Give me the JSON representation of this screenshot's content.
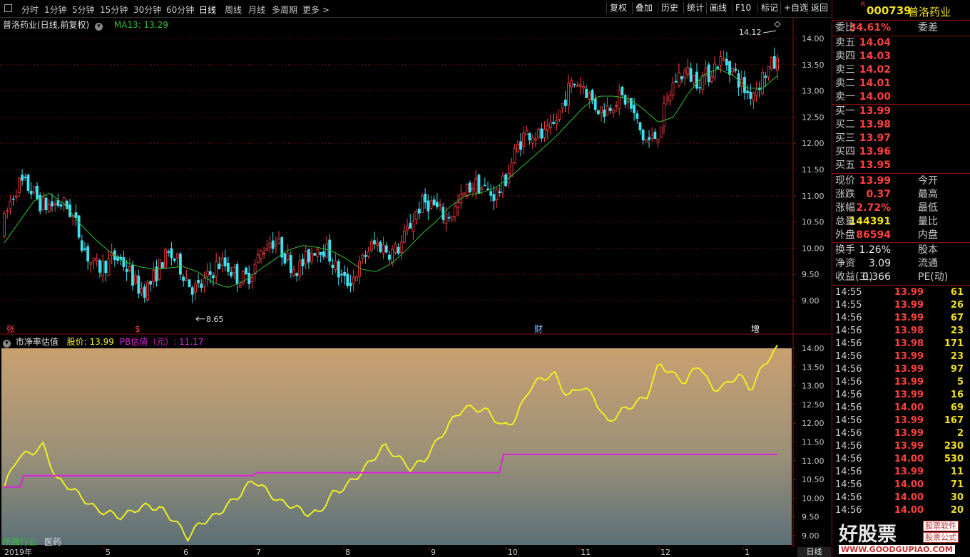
{
  "toolbar": {
    "periods": [
      "分时",
      "1分钟",
      "5分钟",
      "15分钟",
      "30分钟",
      "60分钟",
      "日线",
      "周线",
      "月线",
      "多周期",
      "更多 >"
    ],
    "buttons": [
      "复权",
      "叠加",
      "历史",
      "统计",
      "画线",
      "F10",
      "标记",
      "+自选",
      "返回"
    ]
  },
  "main": {
    "title": "普洛药业(日线,前复权)",
    "ma_label": "MA13: 13.29",
    "high_label": "14.12",
    "low_label": "8.65",
    "y_ticks": [
      "14.00",
      "13.50",
      "13.00",
      "12.50",
      "12.00",
      "11.50",
      "11.00",
      "10.50",
      "10.00",
      "9.50",
      "9.00"
    ],
    "markers": [
      {
        "text": "张",
        "color": "#ff4040"
      },
      {
        "text": "$",
        "color": "#ff4040"
      },
      {
        "text": "财",
        "color": "#80c0ff"
      },
      {
        "text": "增",
        "color": "#ffffff"
      }
    ]
  },
  "lower": {
    "indicator_name": "市净率估值",
    "price_label": "股价: 13.99",
    "pb_label": "PB估值（元）: 11.17",
    "y_ticks": [
      "14.00",
      "13.50",
      "13.00",
      "12.50",
      "12.00",
      "11.50",
      "11.00",
      "10.50",
      "10.00",
      "9.50",
      "9.00"
    ],
    "industry_label": "所属行业",
    "industry_value": "医药"
  },
  "date_axis": {
    "labels": [
      "2019年",
      "5",
      "6",
      "7",
      "8",
      "9",
      "10",
      "11",
      "12",
      "1"
    ],
    "period_tab": "日线"
  },
  "quote": {
    "code": "000739",
    "name": "普洛药业",
    "r_flag": "R",
    "wei_bi_label": "委比",
    "wei_bi": "34.61%",
    "wei_cha_label": "委差",
    "asks": [
      {
        "label": "卖五",
        "price": "14.04"
      },
      {
        "label": "卖四",
        "price": "14.03"
      },
      {
        "label": "卖三",
        "price": "14.02"
      },
      {
        "label": "卖二",
        "price": "14.01"
      },
      {
        "label": "卖一",
        "price": "14.00"
      }
    ],
    "bids": [
      {
        "label": "买一",
        "price": "13.99"
      },
      {
        "label": "买二",
        "price": "13.98"
      },
      {
        "label": "买三",
        "price": "13.97"
      },
      {
        "label": "买四",
        "price": "13.96"
      },
      {
        "label": "买五",
        "price": "13.95"
      }
    ],
    "stats": [
      {
        "l1": "现价",
        "v": "13.99",
        "l2": "今开",
        "color": "red"
      },
      {
        "l1": "涨跌",
        "v": "0.37",
        "l2": "最高",
        "color": "red"
      },
      {
        "l1": "涨幅",
        "v": "2.72%",
        "l2": "最低",
        "color": "red"
      },
      {
        "l1": "总量",
        "v": "144391",
        "l2": "量比",
        "color": "yellow"
      },
      {
        "l1": "外盘",
        "v": "86594",
        "l2": "内盘",
        "color": "red"
      }
    ],
    "stats2": [
      {
        "l1": "换手",
        "v": "1.26%",
        "l2": "股本",
        "color": "white"
      },
      {
        "l1": "净资",
        "v": "3.09",
        "l2": "流通",
        "color": "white"
      },
      {
        "l1": "收益(三)",
        "v": "0.366",
        "l2": "PE(动)",
        "color": "white"
      }
    ],
    "ticks": [
      {
        "t": "14:55",
        "p": "13.99",
        "v": "61",
        "pc": "red",
        "vc": "yellow"
      },
      {
        "t": "14:55",
        "p": "13.99",
        "v": "26",
        "pc": "red",
        "vc": "yellow"
      },
      {
        "t": "14:56",
        "p": "13.99",
        "v": "67",
        "pc": "red",
        "vc": "yellow"
      },
      {
        "t": "14:56",
        "p": "13.98",
        "v": "23",
        "pc": "red",
        "vc": "yellow"
      },
      {
        "t": "14:56",
        "p": "13.98",
        "v": "171",
        "pc": "red",
        "vc": "yellow"
      },
      {
        "t": "14:56",
        "p": "13.99",
        "v": "23",
        "pc": "red",
        "vc": "yellow"
      },
      {
        "t": "14:56",
        "p": "13.99",
        "v": "97",
        "pc": "red",
        "vc": "yellow"
      },
      {
        "t": "14:56",
        "p": "13.99",
        "v": "5",
        "pc": "red",
        "vc": "yellow"
      },
      {
        "t": "14:56",
        "p": "13.99",
        "v": "16",
        "pc": "red",
        "vc": "yellow"
      },
      {
        "t": "14:56",
        "p": "14.00",
        "v": "69",
        "pc": "red",
        "vc": "yellow"
      },
      {
        "t": "14:56",
        "p": "13.99",
        "v": "167",
        "pc": "red",
        "vc": "yellow"
      },
      {
        "t": "14:56",
        "p": "13.99",
        "v": "2",
        "pc": "red",
        "vc": "yellow"
      },
      {
        "t": "14:56",
        "p": "13.99",
        "v": "230",
        "pc": "red",
        "vc": "yellow"
      },
      {
        "t": "14:56",
        "p": "14.00",
        "v": "530",
        "pc": "red",
        "vc": "magenta"
      },
      {
        "t": "14:56",
        "p": "13.99",
        "v": "11",
        "pc": "red",
        "vc": "yellow"
      },
      {
        "t": "14:56",
        "p": "14.00",
        "v": "71",
        "pc": "red",
        "vc": "yellow"
      },
      {
        "t": "14:56",
        "p": "14.00",
        "v": "30",
        "pc": "red",
        "vc": "yellow"
      },
      {
        "t": "14:56",
        "p": "14.00",
        "v": "20",
        "pc": "red",
        "vc": "yellow"
      }
    ]
  },
  "watermark": {
    "brand": "好股票",
    "tag1": "股票软件",
    "tag2": "股票公式",
    "url": "WWW.GOODGUPIAO.COM"
  },
  "colors": {
    "up": "#ff4040",
    "down": "#40e0f0",
    "ma": "#30c030",
    "price_line": "#f0f020",
    "pb_line": "#e020e0",
    "grid": "#8b1010"
  },
  "chart_data": [
    {
      "type": "line",
      "title": "普洛药业(日线,前复权)",
      "series": [
        {
          "name": "MA13",
          "values": [
            10.1,
            10.5,
            10.9,
            11.05,
            10.85,
            10.5,
            10.2,
            9.95,
            9.75,
            9.65,
            9.6,
            9.62,
            9.65,
            9.55,
            9.35,
            9.25,
            9.35,
            9.55,
            9.75,
            9.95,
            10.05,
            10.02,
            9.95,
            9.8,
            9.6,
            9.55,
            9.7,
            9.95,
            10.25,
            10.5,
            10.8,
            11.0,
            11.05,
            11.15,
            11.35,
            11.6,
            11.85,
            12.1,
            12.4,
            12.7,
            12.9,
            12.9,
            12.85,
            12.65,
            12.4,
            12.5,
            12.95,
            13.3,
            13.42,
            13.3,
            13.05,
            13.05,
            13.29
          ]
        }
      ],
      "ylim": [
        8.6,
        14.25
      ]
    },
    {
      "type": "line",
      "title": "市净率估值",
      "series": [
        {
          "name": "股价",
          "values": [
            10.3,
            11.1,
            11.2,
            11.4,
            10.5,
            10.3,
            10.0,
            9.7,
            9.6,
            9.5,
            9.7,
            9.8,
            9.7,
            9.4,
            8.95,
            9.35,
            9.5,
            9.8,
            10.1,
            10.5,
            10.2,
            9.9,
            9.8,
            9.6,
            9.6,
            10.1,
            10.3,
            10.6,
            11.0,
            11.4,
            11.1,
            10.8,
            11.0,
            11.5,
            12.0,
            12.4,
            12.4,
            12.3,
            11.9,
            12.1,
            12.9,
            13.2,
            13.3,
            12.7,
            13.0,
            12.7,
            12.0,
            12.3,
            12.5,
            12.7,
            13.6,
            13.3,
            13.1,
            13.6,
            12.9,
            13.0,
            13.3,
            12.9,
            13.6,
            14.0
          ]
        },
        {
          "name": "PB估值（元）",
          "values": [
            10.28,
            10.6,
            10.6,
            10.6,
            10.6,
            10.7,
            10.75,
            10.75,
            11.2,
            11.2,
            11.2,
            11.2,
            11.2,
            11.2,
            11.17
          ]
        }
      ],
      "ylim": [
        8.8,
        14.1
      ]
    }
  ]
}
